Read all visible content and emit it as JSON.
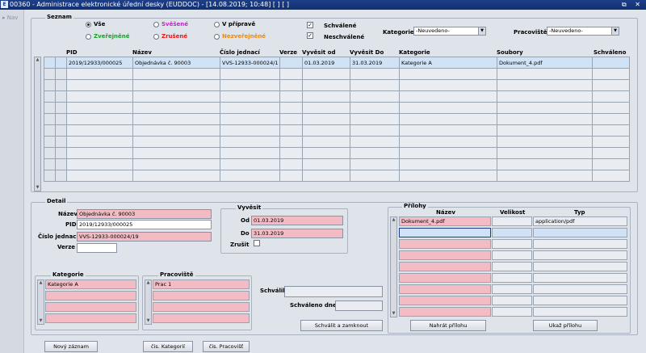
{
  "window": {
    "title": "00360 - Administrace elektronické úřední desky (EUDDOC) - [14.08.2019; 10:48]  [ ]  [ ]",
    "logo_text": "E",
    "controls": "⧉ ✕"
  },
  "sidebar": {
    "nav_label": "Nav"
  },
  "seznam": {
    "title": "Seznam",
    "radios": [
      {
        "label": "Vše",
        "selected": true,
        "color": "#000000"
      },
      {
        "label": "Svěšené",
        "selected": false,
        "color": "#c026c8"
      },
      {
        "label": "V přípravě",
        "selected": false,
        "color": "#000000"
      },
      {
        "label": "Zveřejněné",
        "selected": false,
        "color": "#1e9e2e"
      },
      {
        "label": "Zrušené",
        "selected": false,
        "color": "#e01b1b"
      },
      {
        "label": "Nezveřejněné",
        "selected": false,
        "color": "#e88a1a"
      }
    ],
    "checks": [
      {
        "label": "Schválené",
        "checked": true
      },
      {
        "label": "Neschválené",
        "checked": true
      }
    ],
    "kategorie_label": "Kategorie",
    "kategorie_value": "-Neuvedeno-",
    "pracoviste_label": "Pracoviště",
    "pracoviste_value": "-Neuvedeno-",
    "columns": [
      "PID",
      "Název",
      "Číslo jednací",
      "Verze",
      "Vyvěsit od",
      "Vyvěsit Do",
      "Kategorie",
      "Soubory",
      "Schváleno"
    ],
    "rows": [
      [
        "2019/12933/000025",
        "Objednávka č. 90003",
        "VVS-12933-000024/1",
        "",
        "01.03.2019",
        "31.03.2019",
        "Kategorie A",
        "Dokument_4.pdf",
        ""
      ]
    ],
    "empty_rows": 10
  },
  "detail": {
    "title": "Detail",
    "nazev_label": "Název",
    "nazev": "Objednávka č. 90003",
    "pid_label": "PID",
    "pid": "2019/12933/000025",
    "cj_label": "Číslo jednací",
    "cj": "VVS-12933-000024/19",
    "verze_label": "Verze",
    "verze": "",
    "vyvesit_title": "Vyvěsit",
    "od_label": "Od",
    "od": "01.03.2019",
    "do_label": "Do",
    "do": "31.03.2019",
    "zrusit_label": "Zrušit",
    "kategorie_title": "Kategorie",
    "kategorie_items": [
      "Kategorie A"
    ],
    "pracoviste_title": "Pracoviště",
    "pracoviste_items": [
      "Prac 1"
    ],
    "schvalil_label": "Schválil",
    "schvalil": "",
    "schvaleno_dne_label": "Schváleno dne",
    "schvaleno_dne": "",
    "schvalit_button": "Schválit a zamknout"
  },
  "prilohy": {
    "title": "Přílohy",
    "columns": [
      "Název",
      "Velikost",
      "Typ"
    ],
    "rows": [
      [
        "Dokument_4.pdf",
        "",
        "application/pdf"
      ]
    ],
    "upload_button": "Nahrát přílohu",
    "show_button": "Ukaž přílohu"
  },
  "footer": {
    "new_button": "Nový záznam",
    "cis_kat_button": "čis. Kategorií",
    "cis_prac_button": "čis. Pracovišť"
  }
}
